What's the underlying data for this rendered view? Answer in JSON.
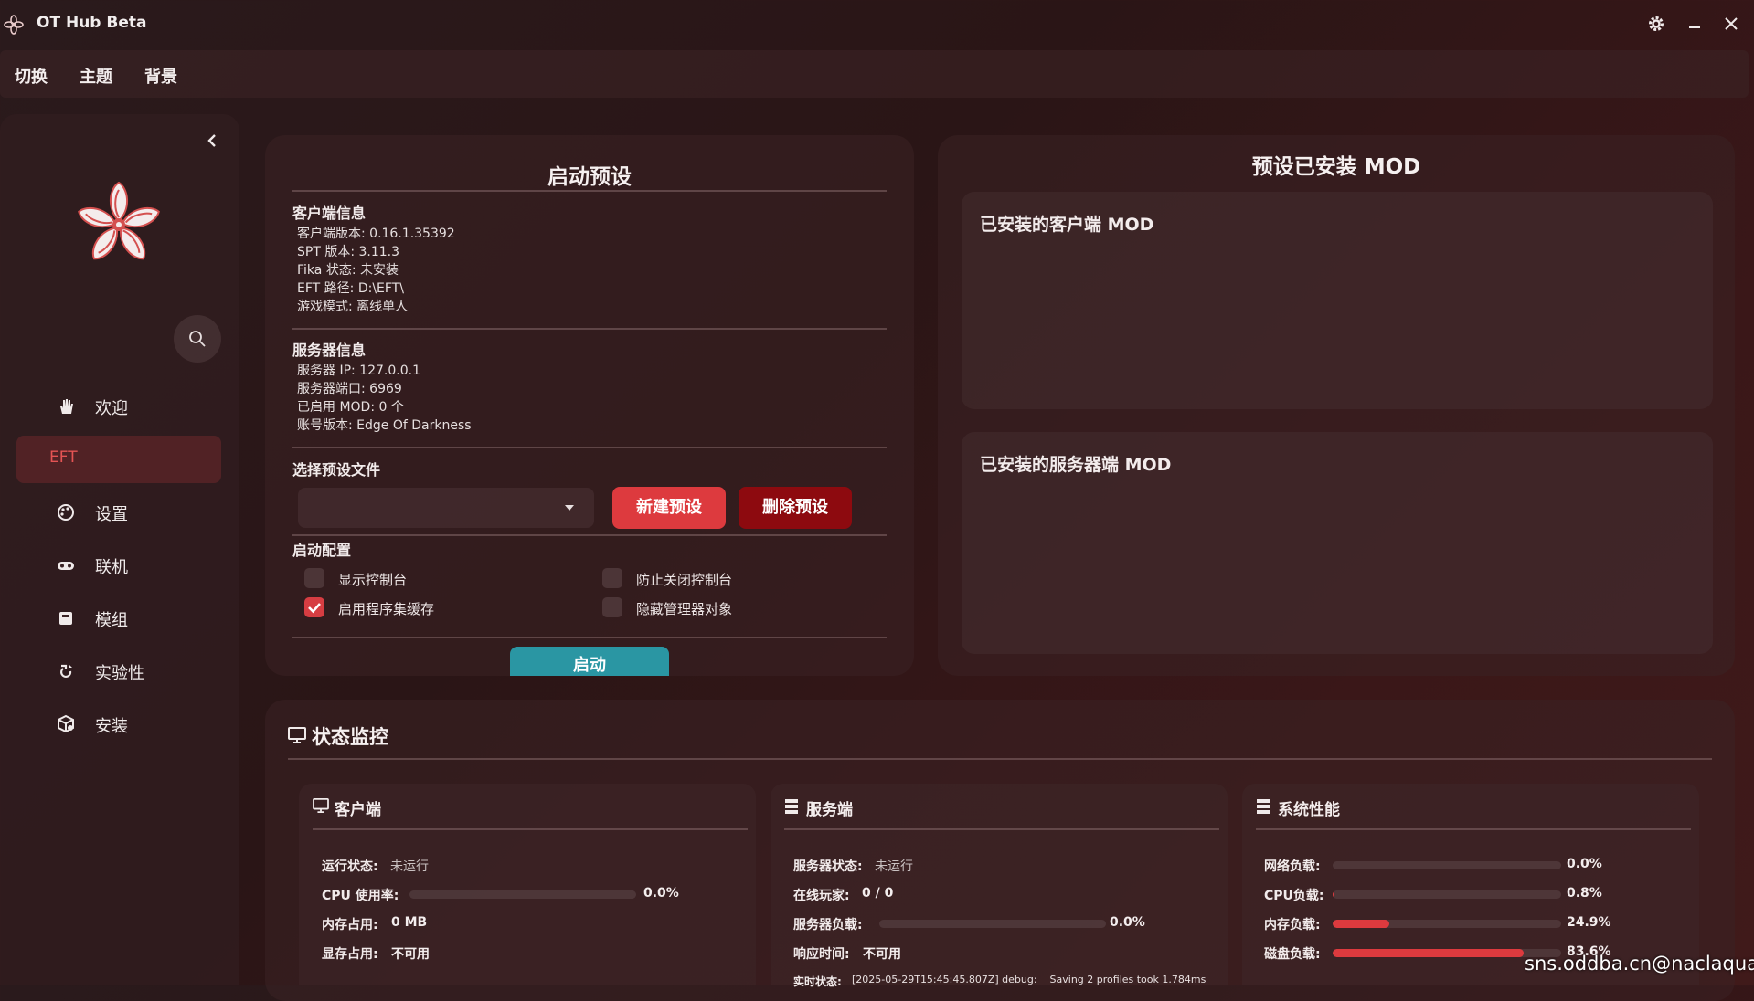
{
  "app": {
    "title": "OT Hub Beta"
  },
  "menu": [
    "切换",
    "主题",
    "背景"
  ],
  "sidebar": {
    "items": [
      {
        "label": "欢迎",
        "icon": "hand-icon"
      },
      {
        "label": "EFT",
        "icon": ""
      },
      {
        "label": "设置",
        "icon": "palette-icon"
      },
      {
        "label": "联机",
        "icon": "gamepad-icon"
      },
      {
        "label": "模组",
        "icon": "mod-box-icon"
      },
      {
        "label": "实验性",
        "icon": "flask-icon"
      },
      {
        "label": "安装",
        "icon": "install-icon"
      }
    ],
    "active": "EFT"
  },
  "launch": {
    "title": "启动预设",
    "client_heading": "客户端信息",
    "client_info": [
      "客户端版本: 0.16.1.35392",
      "SPT 版本: 3.11.3",
      "Fika 状态: 未安装",
      "EFT 路径: D:\\EFT\\",
      "游戏模式: 离线单人"
    ],
    "server_heading": "服务器信息",
    "server_info": [
      "服务器 IP: 127.0.0.1",
      "服务器端口: 6969",
      "已启用 MOD: 0 个",
      "账号版本: Edge Of Darkness"
    ],
    "preset_heading": "选择预设文件",
    "preset_value": "",
    "new_preset": "新建预设",
    "delete_preset": "删除预设",
    "config_heading": "启动配置",
    "options": [
      {
        "label": "显示控制台",
        "checked": false
      },
      {
        "label": "防止关闭控制台",
        "checked": false
      },
      {
        "label": "启用程序集缓存",
        "checked": true
      },
      {
        "label": "隐藏管理器对象",
        "checked": false
      }
    ],
    "launch_button": "启动"
  },
  "mods": {
    "title": "预设已安装 MOD",
    "client_title": "已安装的客户端 MOD",
    "server_title": "已安装的服务器端 MOD"
  },
  "monitor": {
    "title": "状态监控",
    "client": {
      "title": "客户端",
      "run_k": "运行状态:",
      "run_v": "未运行",
      "cpu_k": "CPU 使用率:",
      "cpu_v": "0.0%",
      "cpu_pct": 0.0,
      "mem_k": "内存占用:",
      "mem_v": "0 MB",
      "vram_k": "显存占用:",
      "vram_v": "不可用"
    },
    "server": {
      "title": "服务端",
      "status_k": "服务器状态:",
      "status_v": "未运行",
      "players_k": "在线玩家:",
      "players_v": "0 / 0",
      "load_k": "服务器负载:",
      "load_v": "0.0%",
      "load_pct": 0.0,
      "resp_k": "响应时间:",
      "resp_v": "不可用",
      "realtime_k": "实时状态:",
      "realtime_v": "[2025-05-29T15:45:45.807Z] debug:    Saving 2 profiles took 1.784ms"
    },
    "system": {
      "title": "系统性能",
      "net_k": "网络负载:",
      "net_v": "0.0%",
      "net_pct": 0.0,
      "cpu_k": "CPU负载:",
      "cpu_v": "0.8%",
      "cpu_pct": 0.8,
      "mem_k": "内存负载:",
      "mem_v": "24.9%",
      "mem_pct": 24.9,
      "disk_k": "磁盘负载:",
      "disk_v": "83.6%",
      "disk_pct": 83.6
    }
  },
  "watermark": "sns.oddba.cn@naclaqua",
  "colors": {
    "accent_red": "#dd3a3e",
    "dark_red": "#8d0a0f",
    "launch_teal": "#2a96a3"
  }
}
